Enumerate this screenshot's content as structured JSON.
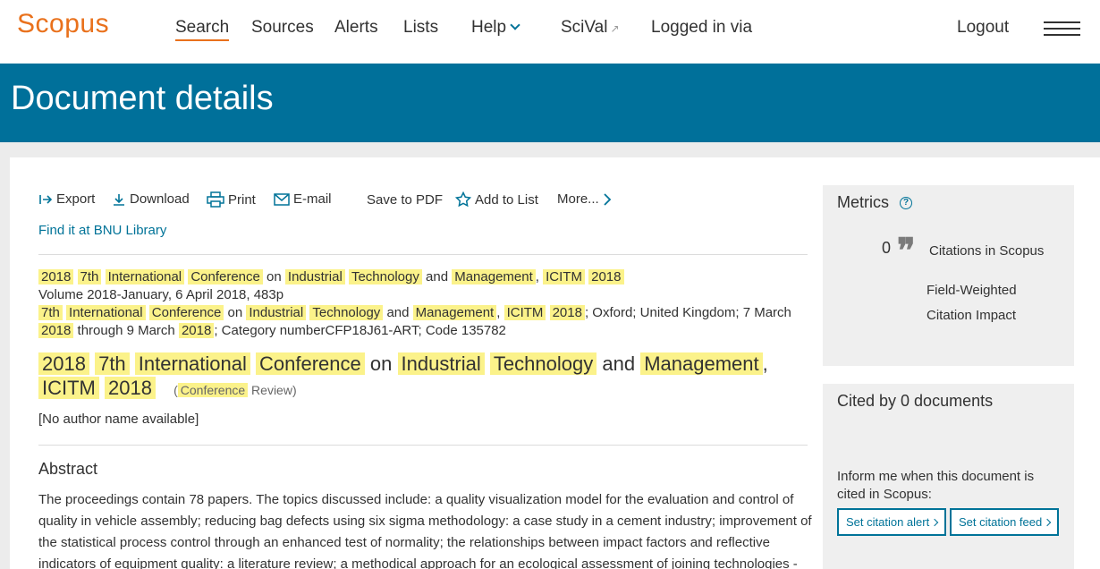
{
  "nav": {
    "logo": "Scopus",
    "items": [
      "Search",
      "Sources",
      "Alerts",
      "Lists",
      "Help",
      "SciVal",
      "Logged in via"
    ],
    "scival_sup": "↗",
    "logout": "Logout"
  },
  "header": {
    "title": "Document details"
  },
  "toolbar": {
    "export": "Export",
    "download": "Download",
    "print": "Print",
    "email": "E-mail",
    "save_pdf": "Save to PDF",
    "add_list": "Add to List",
    "more": "More..."
  },
  "library_link": "Find it at BNU Library",
  "source": {
    "title_words": [
      "2018",
      "7th",
      "International",
      "Conference",
      "on",
      "Industrial",
      "Technology",
      "and",
      "Management",
      ",",
      "ICITM",
      "2018"
    ],
    "volume": "Volume 2018-January, 6 April 2018, 483p",
    "conf_words": [
      "7th",
      "International",
      "Conference",
      "on",
      "Industrial",
      "Technology",
      "and",
      "Management",
      ",",
      "ICITM",
      "2018"
    ],
    "conf_tail1": "; Oxford; United Kingdom; 7 March",
    "conf_year1": "2018",
    "conf_mid": "through 9 March",
    "conf_year2": "2018",
    "conf_tail2": "; Category numberCFP18J61-ART; Code 135782"
  },
  "document": {
    "title_words": [
      "2018",
      "7th",
      "International",
      "Conference",
      "on",
      "Industrial",
      "Technology",
      "and",
      "Management",
      ",",
      "ICITM",
      "2018"
    ],
    "type_open": "(",
    "type_hl": "Conference",
    "type_rest": "Review)",
    "authors": "[No author name available]"
  },
  "abstract": {
    "title": "Abstract",
    "text": "The proceedings contain 78 papers. The topics discussed include: a quality visualization model for the evaluation and control of quality in vehicle assembly; reducing bag defects using six sigma methodology: a case study in a cement industry; improvement of the statistical process control through an enhanced test of normality; the relationships between impact factors and reflective indicators of equipment quality: a literature review; a methodical approach for an ecological assessment of joining technologies -"
  },
  "metrics": {
    "title": "Metrics",
    "help": "?",
    "citations_count": "0",
    "citations_label": "Citations in Scopus",
    "fwci_line1": "Field-Weighted",
    "fwci_line2": "Citation Impact"
  },
  "cited_by": {
    "title": "Cited by 0 documents",
    "inform": "Inform me when this document is cited in Scopus:",
    "alert_btn": "Set citation alert",
    "feed_btn": "Set citation feed"
  },
  "colors": {
    "brand": "#e9711c",
    "header_band": "#00709a",
    "link": "#007398",
    "highlight": "#fbf28a"
  }
}
